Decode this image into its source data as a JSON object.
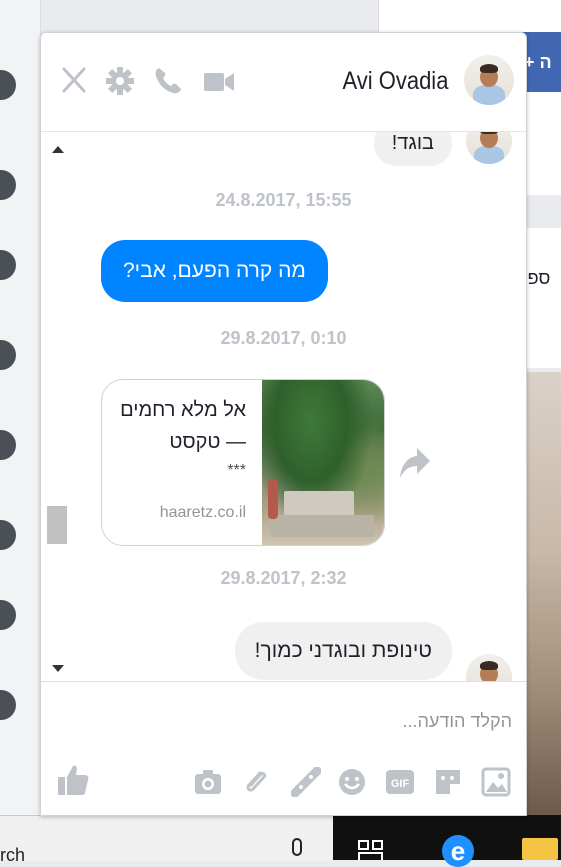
{
  "background": {
    "right_button_text": "+ ה",
    "right_card_text": "ספינ",
    "taskbar_search_text": "rch"
  },
  "chat": {
    "contact_name": "Avi Ovadia",
    "header_icons": [
      "close-icon",
      "gear-icon",
      "phone-icon",
      "video-icon"
    ],
    "messages": [
      {
        "type": "incoming",
        "text": "בוגד!"
      },
      {
        "type": "timestamp",
        "text": "24.8.2017, 15:55"
      },
      {
        "type": "outgoing",
        "text": "מה קרה הפעם, אבי?"
      },
      {
        "type": "timestamp",
        "text": "29.8.2017, 0:10"
      },
      {
        "type": "shared_link",
        "title": "אל מלא רחמים — טקסט",
        "extra": "***",
        "domain": "haaretz.co.il"
      },
      {
        "type": "timestamp",
        "text": "29.8.2017, 2:32"
      },
      {
        "type": "incoming",
        "text": "טינופת ובוגדני כמוך!"
      }
    ],
    "composer": {
      "placeholder": "הקלד הודעה...",
      "tool_icons": [
        "photo-icon",
        "sticker-icon",
        "gif-icon",
        "emoji-icon",
        "games-icon",
        "attachment-icon",
        "camera-icon",
        "like-icon"
      ]
    }
  },
  "colors": {
    "accent": "#0084ff",
    "incoming_bubble": "#f1f0f0",
    "timestamp": "#bec3c9",
    "icon_gray": "#bec3c9",
    "facebook_blue": "#4267b2"
  }
}
